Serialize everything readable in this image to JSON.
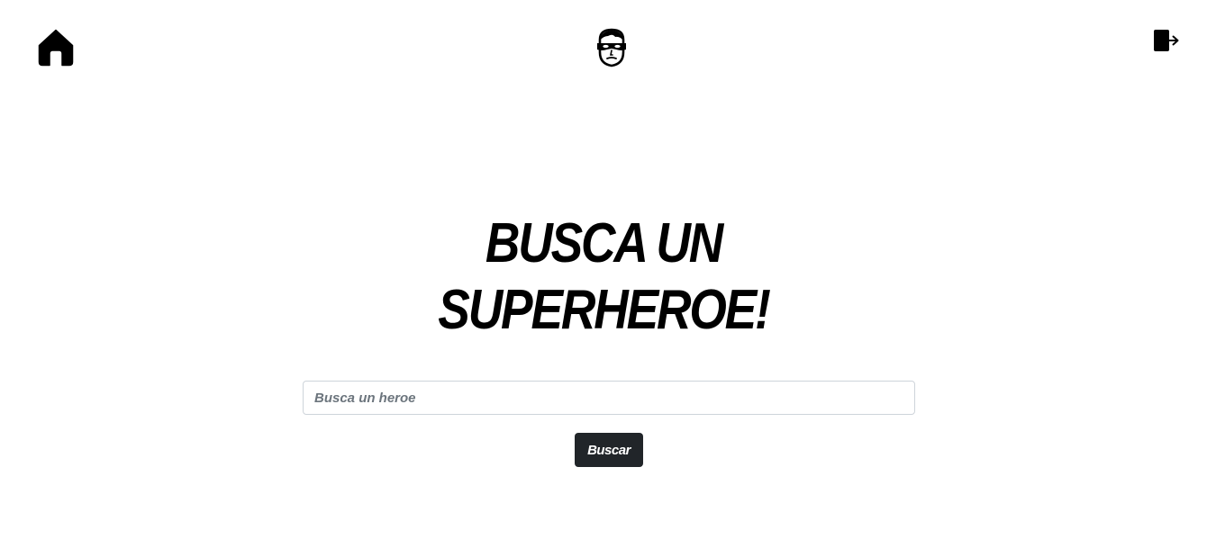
{
  "nav": {
    "home_icon": "home-icon",
    "logo_icon": "superhero-mask-icon",
    "logout_icon": "logout-icon"
  },
  "hero": {
    "title_line1": "BUSCA UN",
    "title_line2": "SUPERHEROE!"
  },
  "search": {
    "placeholder": "Busca un heroe",
    "value": "",
    "button_label": "Buscar"
  },
  "colors": {
    "background": "#ffffff",
    "text": "#000000",
    "button_bg": "#212529",
    "button_text": "#ffffff",
    "input_border": "#ced4da",
    "placeholder": "#6c757d"
  }
}
